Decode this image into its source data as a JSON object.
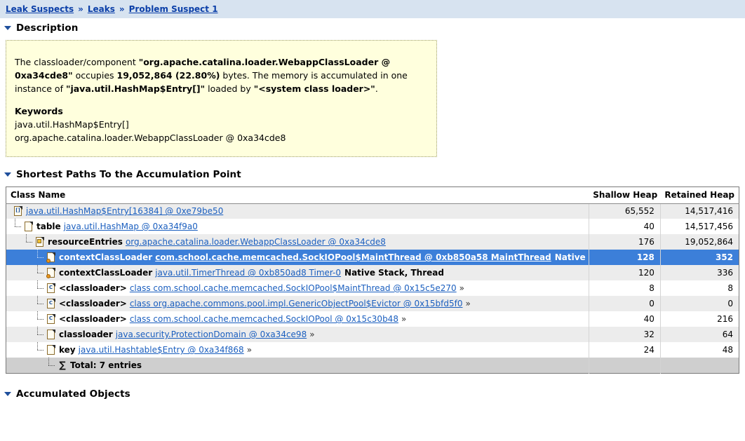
{
  "breadcrumb": {
    "separator": "»",
    "items": [
      {
        "label": "Leak Suspects"
      },
      {
        "label": "Leaks"
      },
      {
        "label": "Problem Suspect 1"
      }
    ]
  },
  "sections": {
    "description": {
      "title": "Description"
    },
    "shortest_paths": {
      "title": "Shortest Paths To the Accumulation Point"
    },
    "accumulated_objects": {
      "title": "Accumulated Objects"
    }
  },
  "description_box": {
    "p1_a": "The classloader/component ",
    "p1_b": "\"org.apache.catalina.loader.WebappClassLoader @ 0xa34cde8\"",
    "p1_c": " occupies ",
    "p1_d": "19,052,864 (22.80%)",
    "p1_e": " bytes. The memory is accumulated in one instance of ",
    "p1_f": "\"java.util.HashMap$Entry[]\"",
    "p1_g": " loaded by ",
    "p1_h": "\"<system class loader>\"",
    "p1_i": ".",
    "keywords_title": "Keywords",
    "keywords": [
      "java.util.HashMap$Entry[]",
      "org.apache.catalina.loader.WebappClassLoader @ 0xa34cde8"
    ]
  },
  "paths_table": {
    "columns": [
      {
        "label": "Class Name"
      },
      {
        "label": "Shallow Heap"
      },
      {
        "label": "Retained Heap"
      }
    ],
    "rows": [
      {
        "indent": 0,
        "icon": "array-icon",
        "icon_glyph": "[]",
        "label": "",
        "link": "java.util.HashMap$Entry[16384] @ 0xe79be50",
        "trailing": "",
        "chevron": "",
        "shallow": "65,552",
        "retained": "14,517,416",
        "selected": false
      },
      {
        "indent": 1,
        "icon": "object-icon",
        "icon_glyph": "",
        "label": "table",
        "link": "java.util.HashMap @ 0xa34f9a0",
        "trailing": "",
        "chevron": "",
        "shallow": "40",
        "retained": "14,517,456",
        "selected": false
      },
      {
        "indent": 2,
        "icon": "classloader-object-icon",
        "icon_glyph": "",
        "label": "resourceEntries",
        "link": "org.apache.catalina.loader.WebappClassLoader @ 0xa34cde8",
        "trailing": "",
        "chevron": "",
        "shallow": "176",
        "retained": "19,052,864",
        "selected": false
      },
      {
        "indent": 3,
        "icon": "thread-object-icon",
        "icon_glyph": "",
        "label": "contextClassLoader",
        "link": "com.school.cache.memcached.SockIOPool$MaintThread @ 0xb850a58 MaintThread",
        "trailing": "Native Stack, Thread",
        "chevron": "",
        "shallow": "128",
        "retained": "352",
        "selected": true
      },
      {
        "indent": 3,
        "icon": "thread-object-icon",
        "icon_glyph": "",
        "label": "contextClassLoader",
        "link": "java.util.TimerThread @ 0xb850ad8 Timer-0",
        "trailing": "Native Stack, Thread",
        "chevron": "",
        "shallow": "120",
        "retained": "336",
        "selected": false
      },
      {
        "indent": 3,
        "icon": "class-icon",
        "icon_glyph": "C",
        "label": "<classloader>",
        "link": "class com.school.cache.memcached.SockIOPool$MaintThread @ 0x15c5e270",
        "trailing": "",
        "chevron": "»",
        "shallow": "8",
        "retained": "8",
        "selected": false
      },
      {
        "indent": 3,
        "icon": "class-icon",
        "icon_glyph": "C",
        "label": "<classloader>",
        "link": "class org.apache.commons.pool.impl.GenericObjectPool$Evictor @ 0x15bfd5f0",
        "trailing": "",
        "chevron": "»",
        "shallow": "0",
        "retained": "0",
        "selected": false
      },
      {
        "indent": 3,
        "icon": "class-icon",
        "icon_glyph": "C",
        "label": "<classloader>",
        "link": "class com.school.cache.memcached.SockIOPool @ 0x15c30b48",
        "trailing": "",
        "chevron": "»",
        "shallow": "40",
        "retained": "216",
        "selected": false
      },
      {
        "indent": 3,
        "icon": "object-icon",
        "icon_glyph": "",
        "label": "classloader",
        "link": "java.security.ProtectionDomain @ 0xa34ce98",
        "trailing": "",
        "chevron": "»",
        "shallow": "32",
        "retained": "64",
        "selected": false
      },
      {
        "indent": 3,
        "icon": "object-icon",
        "icon_glyph": "",
        "label": "key",
        "link": "java.util.Hashtable$Entry @ 0xa34f868",
        "trailing": "",
        "chevron": "»",
        "shallow": "24",
        "retained": "48",
        "selected": false
      }
    ],
    "total_row": {
      "icon": "sum-icon",
      "icon_glyph": "∑",
      "label": "Total: 7 entries",
      "shallow": "",
      "retained": ""
    }
  },
  "colors": {
    "breadcrumb_bg": "#d7e3f0",
    "link": "#1b5fbf",
    "breadcrumb_link": "#0b3fa8",
    "selection": "#3c7fd9",
    "description_bg": "#ffffdd",
    "row_odd": "#ececec",
    "total_row_bg": "#cfcfcf"
  }
}
